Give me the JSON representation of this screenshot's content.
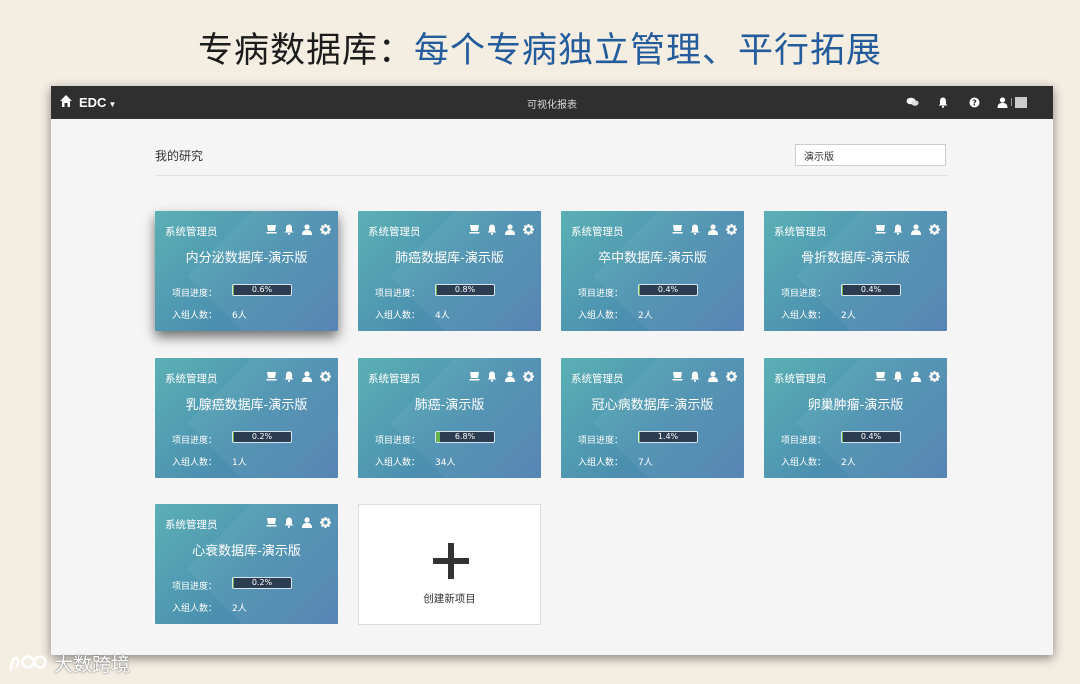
{
  "slide": {
    "title_black": "专病数据库：",
    "title_blue": "每个专病独立管理、平行拓展"
  },
  "navbar": {
    "brand": "EDC",
    "center": "可视化报表",
    "icons": [
      "comments-icon",
      "bell-icon",
      "help-icon",
      "user-icon"
    ]
  },
  "section": {
    "title": "我的研究"
  },
  "search": {
    "value": "演示版"
  },
  "labels": {
    "progress": "项目进度：",
    "members": "入组人数："
  },
  "cards": [
    {
      "owner": "系统管理员",
      "name": "内分泌数据库-演示版",
      "progress": "0.6%",
      "progress_value": 0.6,
      "members": "6人"
    },
    {
      "owner": "系统管理员",
      "name": "肺癌数据库-演示版",
      "progress": "0.8%",
      "progress_value": 0.8,
      "members": "4人"
    },
    {
      "owner": "系统管理员",
      "name": "卒中数据库-演示版",
      "progress": "0.4%",
      "progress_value": 0.4,
      "members": "2人"
    },
    {
      "owner": "系统管理员",
      "name": "骨折数据库-演示版",
      "progress": "0.4%",
      "progress_value": 0.4,
      "members": "2人"
    },
    {
      "owner": "系统管理员",
      "name": "乳腺癌数据库-演示版",
      "progress": "0.2%",
      "progress_value": 0.2,
      "members": "1人"
    },
    {
      "owner": "系统管理员",
      "name": "肺癌-演示版",
      "progress": "6.8%",
      "progress_value": 6.8,
      "members": "34人"
    },
    {
      "owner": "系统管理员",
      "name": "冠心病数据库-演示版",
      "progress": "1.4%",
      "progress_value": 1.4,
      "members": "7人"
    },
    {
      "owner": "系统管理员",
      "name": "卵巢肿瘤-演示版",
      "progress": "0.4%",
      "progress_value": 0.4,
      "members": "2人"
    },
    {
      "owner": "系统管理员",
      "name": "心衰数据库-演示版",
      "progress": "0.2%",
      "progress_value": 0.2,
      "members": "2人"
    }
  ],
  "new_project": {
    "label": "创建新项目"
  },
  "watermark": {
    "text": "大数跨境"
  },
  "colors": {
    "navbar": "#2f2f2f",
    "card_start": "#5bb0b4",
    "card_end": "#4f7fb0",
    "title_blue": "#245b9a",
    "progress_fill": "#65b54b"
  }
}
